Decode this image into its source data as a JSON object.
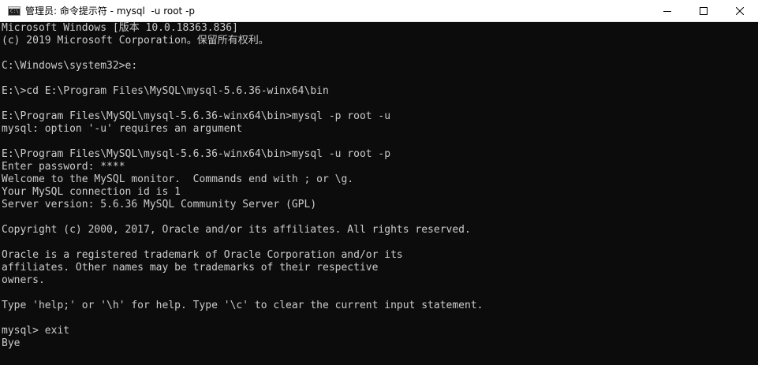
{
  "window": {
    "title": "管理员: 命令提示符 - mysql  -u root -p",
    "icon": "console-icon",
    "controls": {
      "minimize": "minimize-icon",
      "maximize": "maximize-icon",
      "close": "close-icon"
    }
  },
  "console": {
    "foreground": "#cccccc",
    "background": "#0c0c0c",
    "lines": [
      "Microsoft Windows [版本 10.0.18363.836]",
      "(c) 2019 Microsoft Corporation。保留所有权利。",
      "",
      "C:\\Windows\\system32>e:",
      "",
      "E:\\>cd E:\\Program Files\\MySQL\\mysql-5.6.36-winx64\\bin",
      "",
      "E:\\Program Files\\MySQL\\mysql-5.6.36-winx64\\bin>mysql -p root -u",
      "mysql: option '-u' requires an argument",
      "",
      "E:\\Program Files\\MySQL\\mysql-5.6.36-winx64\\bin>mysql -u root -p",
      "Enter password: ****",
      "Welcome to the MySQL monitor.  Commands end with ; or \\g.",
      "Your MySQL connection id is 1",
      "Server version: 5.6.36 MySQL Community Server (GPL)",
      "",
      "Copyright (c) 2000, 2017, Oracle and/or its affiliates. All rights reserved.",
      "",
      "Oracle is a registered trademark of Oracle Corporation and/or its",
      "affiliates. Other names may be trademarks of their respective",
      "owners.",
      "",
      "Type 'help;' or '\\h' for help. Type '\\c' to clear the current input statement.",
      "",
      "mysql> exit",
      "Bye"
    ]
  }
}
